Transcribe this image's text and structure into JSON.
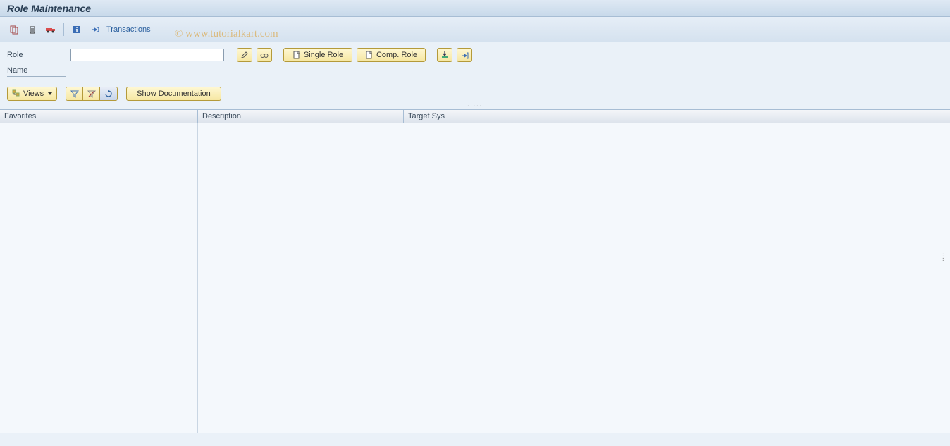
{
  "title": "Role Maintenance",
  "toolbar": {
    "transactions_label": "Transactions"
  },
  "form": {
    "role_label": "Role",
    "role_value": "",
    "name_label": "Name",
    "single_role_label": "Single Role",
    "comp_role_label": "Comp. Role"
  },
  "filters": {
    "views_label": "Views",
    "show_doc_label": "Show Documentation"
  },
  "grid": {
    "headers": {
      "favorites": "Favorites",
      "description": "Description",
      "target_sys": "Target Sys"
    }
  },
  "watermark": "© www.tutorialkart.com"
}
